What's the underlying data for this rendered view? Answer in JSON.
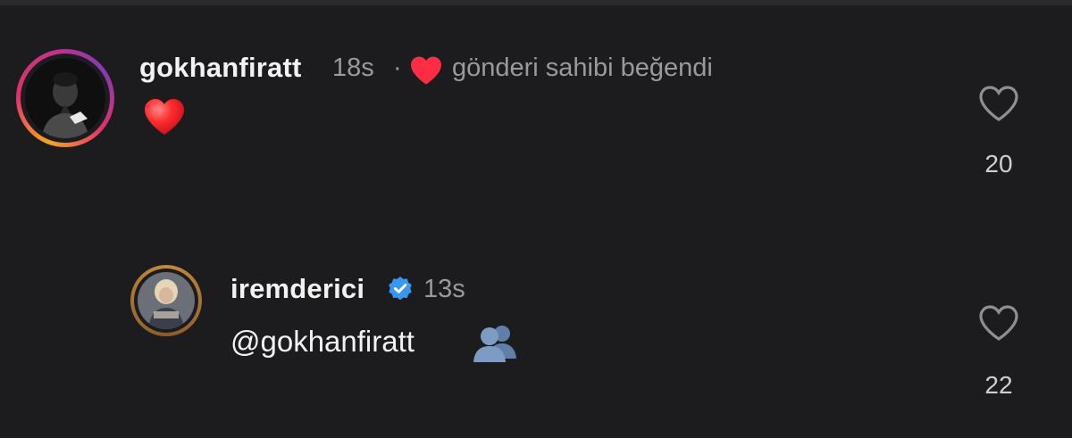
{
  "colors": {
    "background": "#1c1c1e",
    "heart_red": "#ff2d44",
    "verified_blue": "#3897f0",
    "muted_text": "#9a9a9e"
  },
  "comments": [
    {
      "username": "gokhanfiratt",
      "time": "18s",
      "separator": "·",
      "owner_liked_text": "gönderi sahibi beğendi",
      "body_emoji": "red-heart-emoji",
      "like_count": "20",
      "avatar_icon": "profile-photo-man"
    },
    {
      "username": "iremderici",
      "verified": true,
      "time": "13s",
      "body_text": "@gokhanfiratt",
      "body_emoji": "busts-in-silhouette-emoji",
      "like_count": "22",
      "avatar_icon": "profile-photo-woman"
    }
  ]
}
